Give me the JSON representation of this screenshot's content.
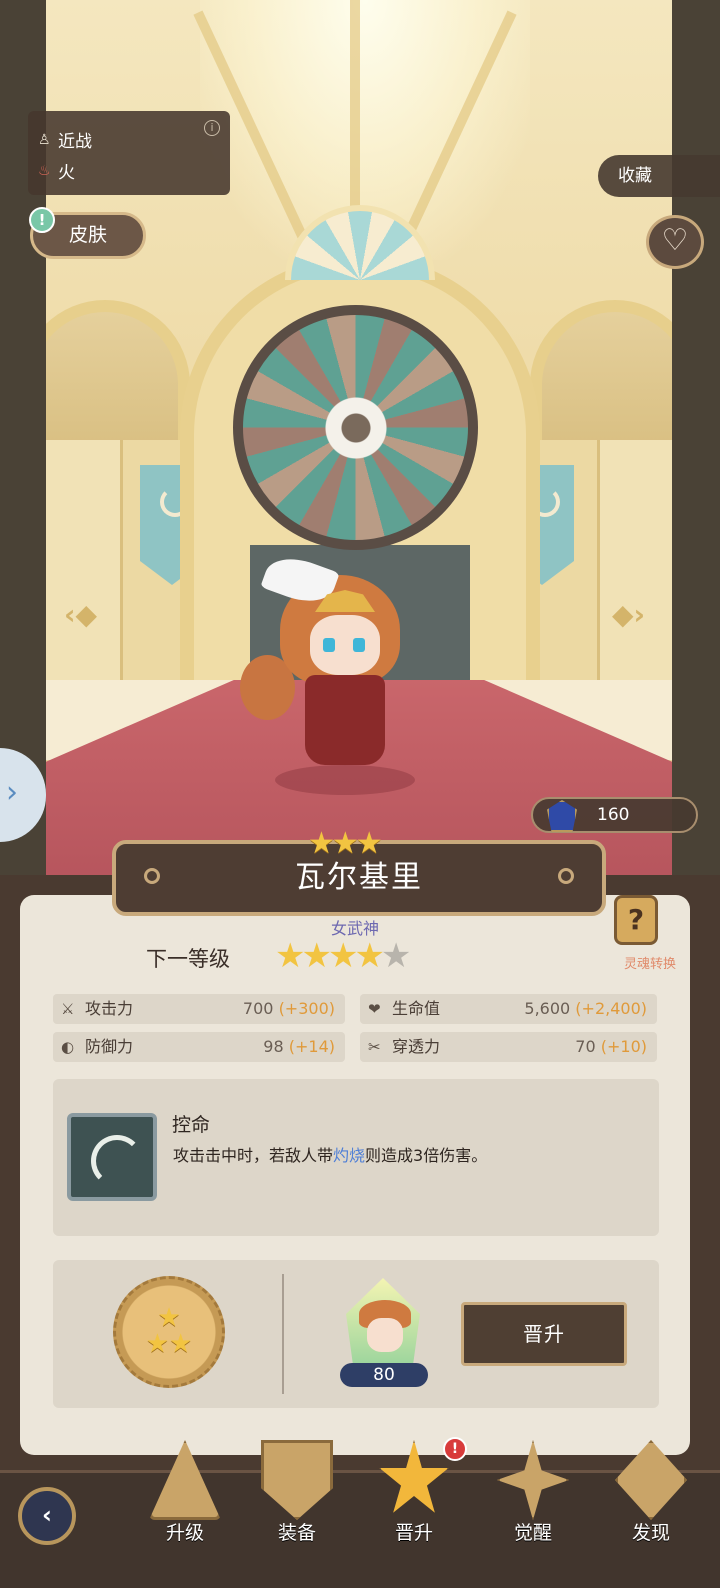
{
  "hero": {
    "attack_type": "近战",
    "element": "火",
    "name": "瓦尔基里",
    "title": "女武神",
    "current_stars": 3,
    "next_stars": 4,
    "max_stars": 5
  },
  "buttons": {
    "skin": "皮肤",
    "collect": "收藏",
    "promote": "晋升"
  },
  "gems": {
    "count": "160"
  },
  "next_level_label": "下一等级",
  "soul_convert": {
    "icon_text": "?",
    "label": "灵魂转换"
  },
  "stats": [
    {
      "icon": "sword-icon",
      "label": "攻击力",
      "value": "700",
      "increase": "(+300)"
    },
    {
      "icon": "heart-icon",
      "label": "生命值",
      "value": "5,600",
      "increase": "(+2,400)"
    },
    {
      "icon": "shield-icon",
      "label": "防御力",
      "value": "98",
      "increase": "(+14)"
    },
    {
      "icon": "pierce-icon",
      "label": "穿透力",
      "value": "70",
      "increase": "(+10)"
    }
  ],
  "skill": {
    "name": "控命",
    "desc_prefix": "攻击击中时，若敌人带",
    "desc_keyword": "灼烧",
    "desc_suffix": "则造成3倍伤害。"
  },
  "promotion": {
    "fragment_count": "80"
  },
  "nav": {
    "items": [
      {
        "label": "升级",
        "icon": "upgrade-icon"
      },
      {
        "label": "装备",
        "icon": "equipment-icon"
      },
      {
        "label": "晋升",
        "icon": "promote-icon",
        "active": true
      },
      {
        "label": "觉醒",
        "icon": "awaken-icon"
      },
      {
        "label": "发现",
        "icon": "discover-icon"
      }
    ],
    "badge": "!"
  },
  "colors": {
    "accent_gold": "#f2c441",
    "increase": "#e09a3a",
    "keyword": "#4f7fd6",
    "panel": "#ece6da"
  }
}
